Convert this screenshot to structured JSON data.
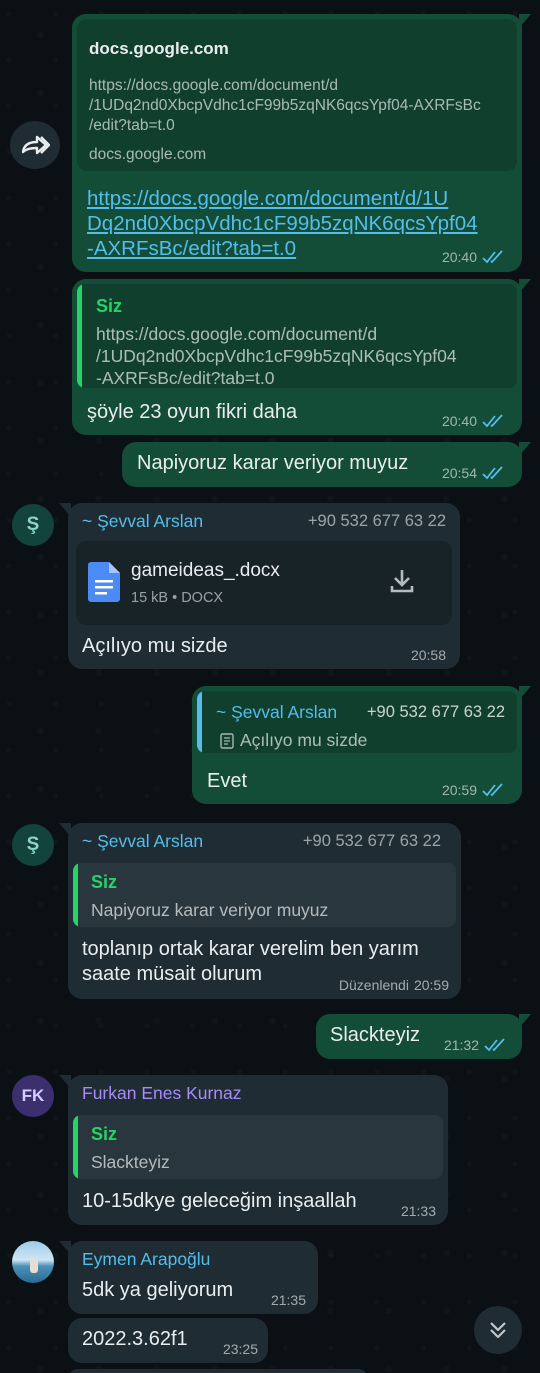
{
  "colors": {
    "outgoing_bubble": "#144d37",
    "incoming_bubble": "#1f2c33",
    "link": "#53bdeb",
    "read_ticks": "#53bdeb",
    "quote_bar_self": "#25d366",
    "sevval_name": "#53bdeb",
    "furkan_name": "#a78bfa"
  },
  "forward_icon": "forward-icon",
  "messages": {
    "m1": {
      "preview_title": "docs.google.com",
      "preview_url_l1": "https://docs.google.com/document/d",
      "preview_url_l2": "/1UDq2nd0XbcpVdhc1cF99b5zqNK6qcsYpf04-AXRFsBc",
      "preview_url_l3": "/edit?tab=t.0",
      "preview_domain": "docs.google.com",
      "link_l1": "https://docs.google.com/document/d/1U",
      "link_l2": "Dq2nd0XbcpVdhc1cF99b5zqNK6qcsYpf04",
      "link_l3": "-AXRFsBc/edit?tab=t.0",
      "time": "20:40"
    },
    "m2": {
      "quote_name": "Siz",
      "quote_l1": "https://docs.google.com/document/d",
      "quote_l2": "/1UDq2nd0XbcpVdhc1cF99b5zqNK6qcsYpf04",
      "quote_l3": "-AXRFsBc/edit?tab=t.0",
      "text": "şöyle 23 oyun fikri daha",
      "time": "20:40"
    },
    "m3": {
      "text": "Napiyoruz karar veriyor muyuz",
      "time": "20:54"
    },
    "m4": {
      "avatar": "Ş",
      "sender": "~ Şevval Arslan",
      "phone": "+90 532 677 63 22",
      "file_name": "gameideas_.docx",
      "file_meta": "15 kB • DOCX",
      "text": "Açılıyo mu sizde",
      "time": "20:58"
    },
    "m5": {
      "quote_name": "~ Şevval Arslan",
      "quote_phone": "+90 532 677 63 22",
      "quote_text": "Açılıyo mu sizde",
      "text": "Evet",
      "time": "20:59"
    },
    "m6": {
      "avatar": "Ş",
      "sender": "~ Şevval Arslan",
      "phone": "+90 532 677 63 22",
      "quote_name": "Siz",
      "quote_text": "Napiyoruz karar veriyor muyuz",
      "text_l1": "toplanıp ortak karar verelim ben yarım",
      "text_l2": "saate müsait olurum",
      "edited": "Düzenlendi",
      "time": "20:59"
    },
    "m7": {
      "text": "Slackteyiz",
      "time": "21:32"
    },
    "m8": {
      "avatar": "FK",
      "sender": "Furkan Enes Kurnaz",
      "quote_name": "Siz",
      "quote_text": "Slackteyiz",
      "text": "10-15dkye geleceğim inşaallah",
      "time": "21:33"
    },
    "m9": {
      "sender": "Eymen Arapoğlu",
      "text": "5dk ya geliyorum",
      "time": "21:35"
    },
    "m10": {
      "text": "2022.3.62f1",
      "time": "23:25"
    }
  },
  "scroll_down_icon": "double-chevron-down-icon"
}
